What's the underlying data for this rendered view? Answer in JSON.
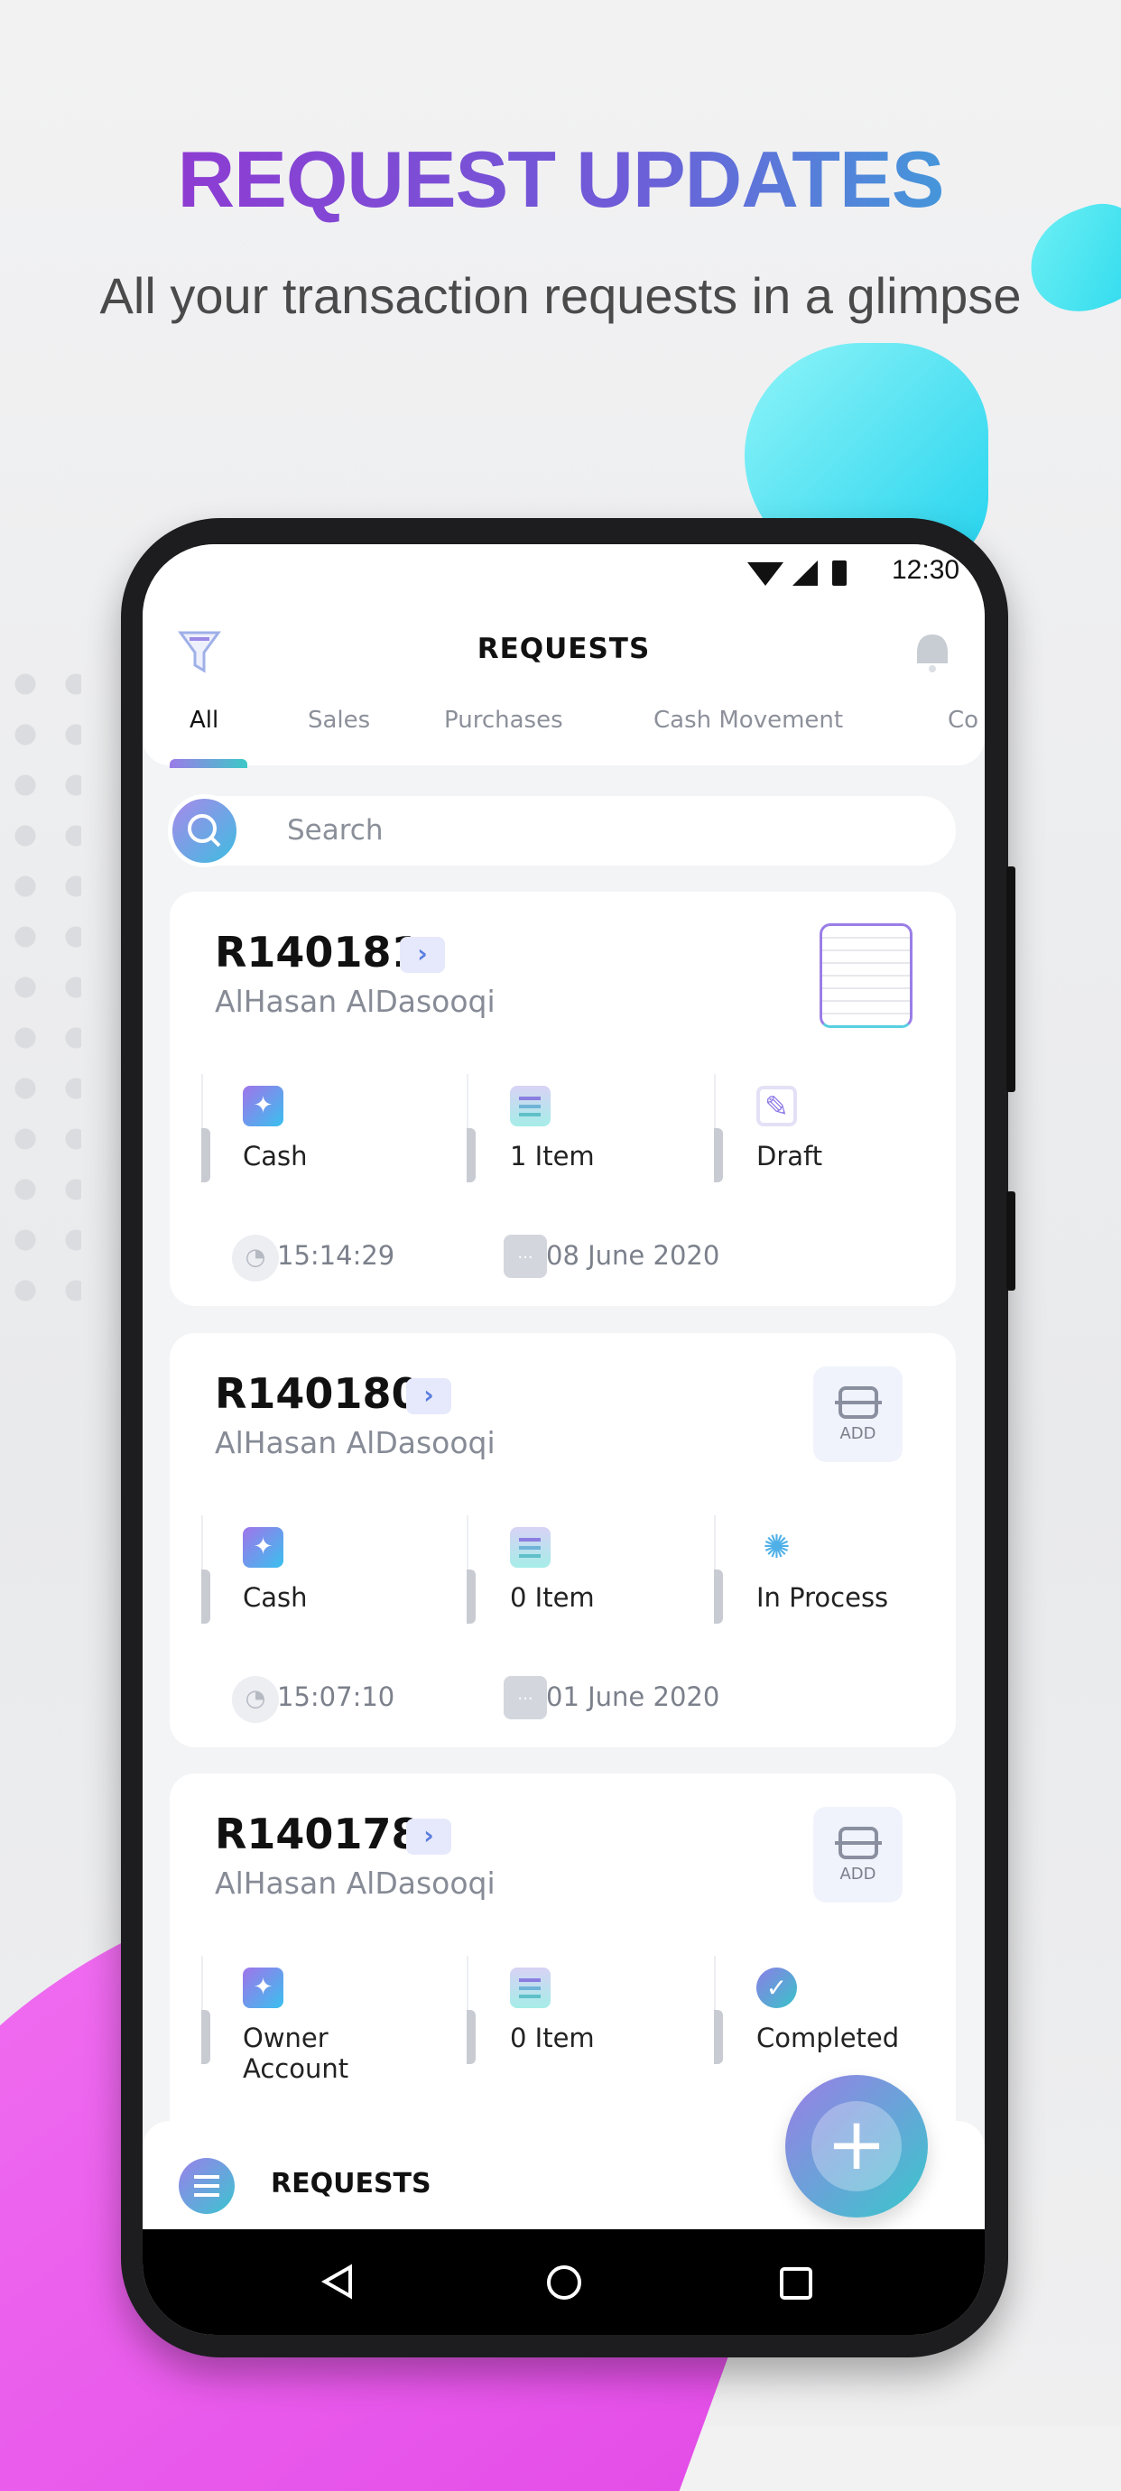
{
  "promo": {
    "headline": "REQUEST UPDATES",
    "subtitle": "All your transaction requests in a glimpse"
  },
  "status_bar": {
    "time": "12:30",
    "icons": [
      "wifi-icon",
      "signal-icon",
      "battery-icon"
    ]
  },
  "header": {
    "title": "REQUESTS",
    "left_icon": "filter-icon",
    "right_icon": "bell-icon"
  },
  "tabs": [
    {
      "label": "All",
      "active": true
    },
    {
      "label": "Sales"
    },
    {
      "label": "Purchases"
    },
    {
      "label": "Cash Movement"
    },
    {
      "label": "Co"
    }
  ],
  "search": {
    "placeholder": "Search"
  },
  "requests": [
    {
      "id": "R140181",
      "name": "AlHasan AlDasooqi",
      "payment": "Cash",
      "items": "1 Item",
      "status": "Draft",
      "time": "15:14:29",
      "date": "08 June 2020",
      "attachment": "receipt-thumbnail"
    },
    {
      "id": "R140180",
      "name": "AlHasan AlDasooqi",
      "payment": "Cash",
      "items": "0 Item",
      "status": "In Process",
      "time": "15:07:10",
      "date": "01 June 2020",
      "add_label": "ADD"
    },
    {
      "id": "R140178",
      "name": "AlHasan AlDasooqi",
      "payment": "Owner Account",
      "items": "0 Item",
      "status": "Completed",
      "add_label": "ADD"
    }
  ],
  "bottom_bar": {
    "label": "REQUESTS"
  },
  "colors": {
    "accent_purple": "#9b7ee6",
    "accent_teal": "#38c8cb",
    "headline_start": "#9a2fd0",
    "headline_end": "#2fb6dc"
  }
}
